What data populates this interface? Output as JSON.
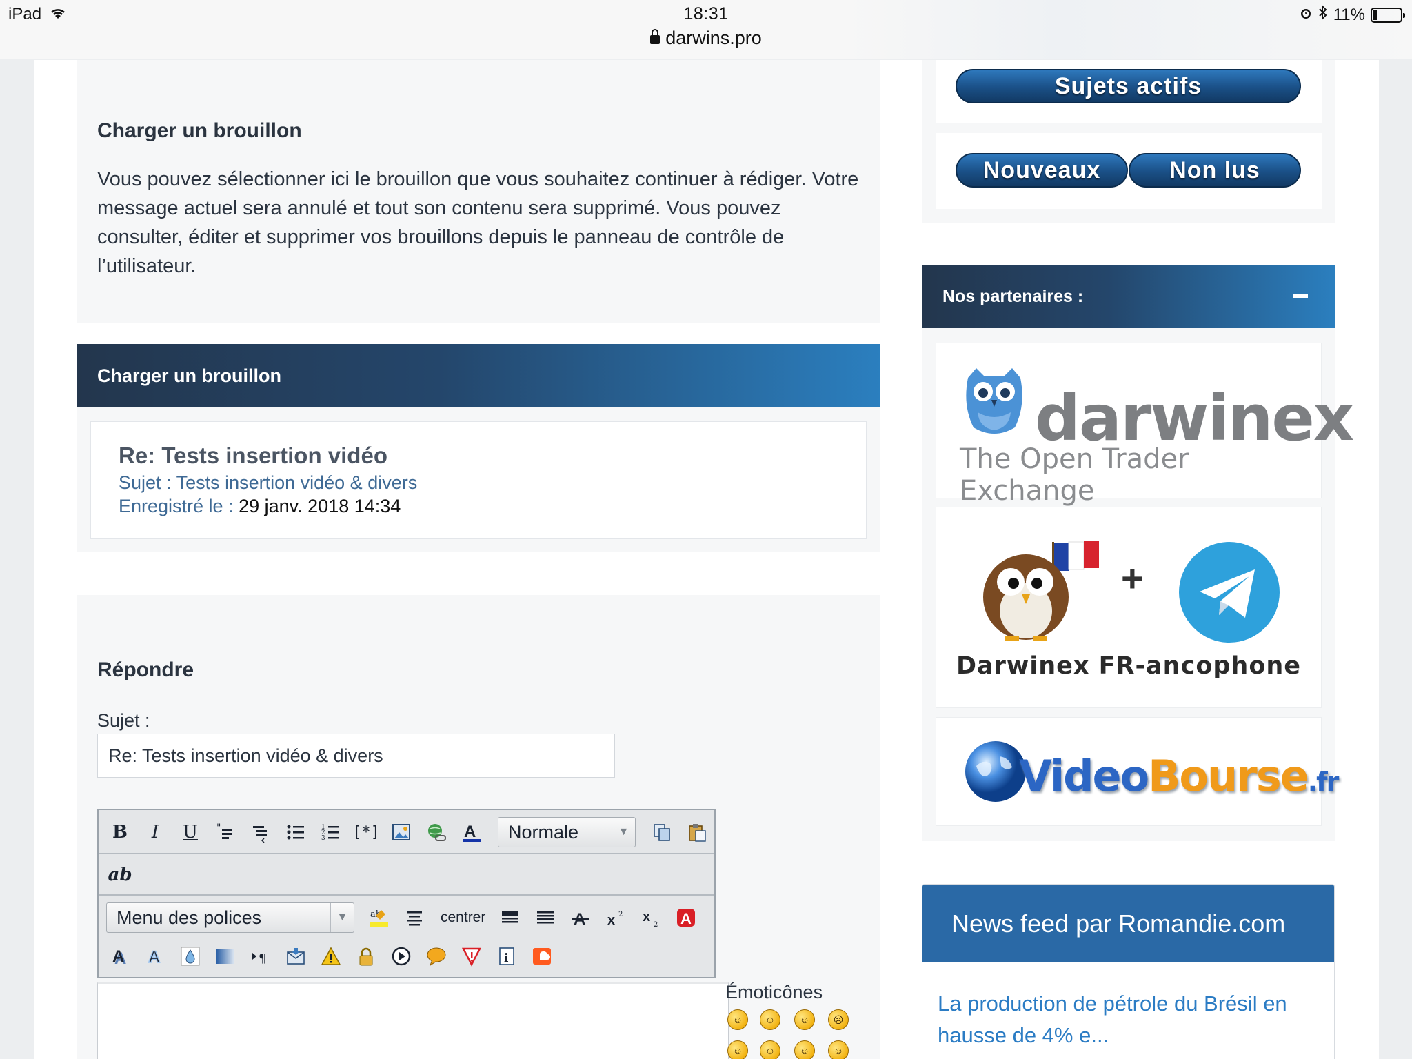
{
  "status_bar": {
    "device": "iPad",
    "time": "18:31",
    "url": "darwins.pro",
    "battery": "11%"
  },
  "load_draft_info": {
    "heading": "Charger un brouillon",
    "description": "Vous pouvez sélectionner ici le brouillon que vous souhaitez continuer à rédiger. Votre message actuel sera annulé et tout son contenu sera supprimé. Vous pouvez consulter, éditer et supprimer vos brouillons depuis le panneau de contrôle de l’utilisateur."
  },
  "drafts_panel": {
    "title": "Charger un brouillon",
    "drafts": [
      {
        "title": "Re: Tests insertion vidéo",
        "subject_label": "Sujet :",
        "subject_value": "Tests insertion vidéo & divers",
        "saved_label": "Enregistré le :",
        "saved_value": "29 janv. 2018 14:34"
      }
    ]
  },
  "reply": {
    "heading": "Répondre",
    "subject_label": "Sujet :",
    "subject_value": "Re: Tests insertion vidéo & divers",
    "toolbar": {
      "row1": [
        "B",
        "I",
        "U"
      ],
      "size_select": "Normale",
      "row2_label": "ab",
      "font_select": "Menu des polices",
      "center_label": "centrer"
    },
    "emoticons_label": "Émoticônes"
  },
  "sidebar": {
    "active_topics": "Sujets actifs",
    "new_button": "Nouveaux",
    "unread_button": "Non lus",
    "partners_title": "Nos partenaires :",
    "partners": [
      {
        "name": "darwinex",
        "tagline": "The Open Trader Exchange"
      },
      {
        "name": "Darwinex FR-ancophone",
        "plus": "+"
      },
      {
        "name_a": "Video",
        "name_b": "Bourse",
        "name_c": ".fr"
      }
    ],
    "news_title": "News feed par Romandie.com",
    "news_link": "La production de pétrole du Brésil en hausse de 4% e..."
  },
  "colors": {
    "bar_dark": "#23364d",
    "bar_light": "#2b7fbf",
    "news_head": "#2a69a6",
    "link": "#2b7cc4"
  }
}
